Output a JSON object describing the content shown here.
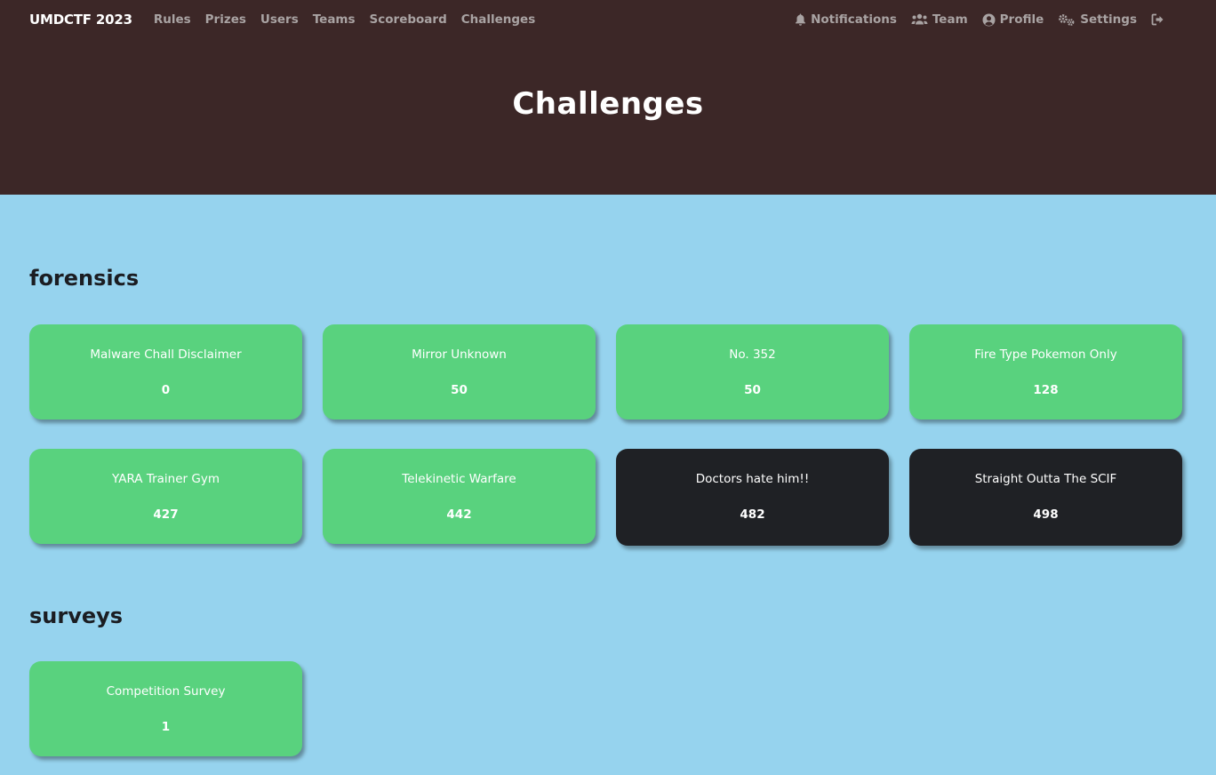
{
  "nav": {
    "brand": "UMDCTF 2023",
    "links": [
      "Rules",
      "Prizes",
      "Users",
      "Teams",
      "Scoreboard",
      "Challenges"
    ],
    "right": {
      "notifications": "Notifications",
      "team": "Team",
      "profile": "Profile",
      "settings": "Settings"
    }
  },
  "header": {
    "title": "Challenges"
  },
  "categories": [
    {
      "name": "forensics",
      "challenges": [
        {
          "name": "Malware Chall Disclaimer",
          "value": "0",
          "solved": true
        },
        {
          "name": "Mirror Unknown",
          "value": "50",
          "solved": true
        },
        {
          "name": "No. 352",
          "value": "50",
          "solved": true
        },
        {
          "name": "Fire Type Pokemon Only",
          "value": "128",
          "solved": true
        },
        {
          "name": "YARA Trainer Gym",
          "value": "427",
          "solved": true
        },
        {
          "name": "Telekinetic Warfare",
          "value": "442",
          "solved": true
        },
        {
          "name": "Doctors hate him!!",
          "value": "482",
          "solved": false
        },
        {
          "name": "Straight Outta The SCIF",
          "value": "498",
          "solved": false
        }
      ]
    },
    {
      "name": "surveys",
      "challenges": [
        {
          "name": "Competition Survey",
          "value": "1",
          "solved": true
        }
      ]
    }
  ],
  "colors": {
    "header_bg": "#3c2727",
    "page_bg": "#96d3ee",
    "solved": "#59d27e",
    "unsolved": "#1f2125"
  },
  "icons": [
    "bell-icon",
    "users-icon",
    "user-circle-icon",
    "cogs-icon",
    "sign-out-icon"
  ]
}
